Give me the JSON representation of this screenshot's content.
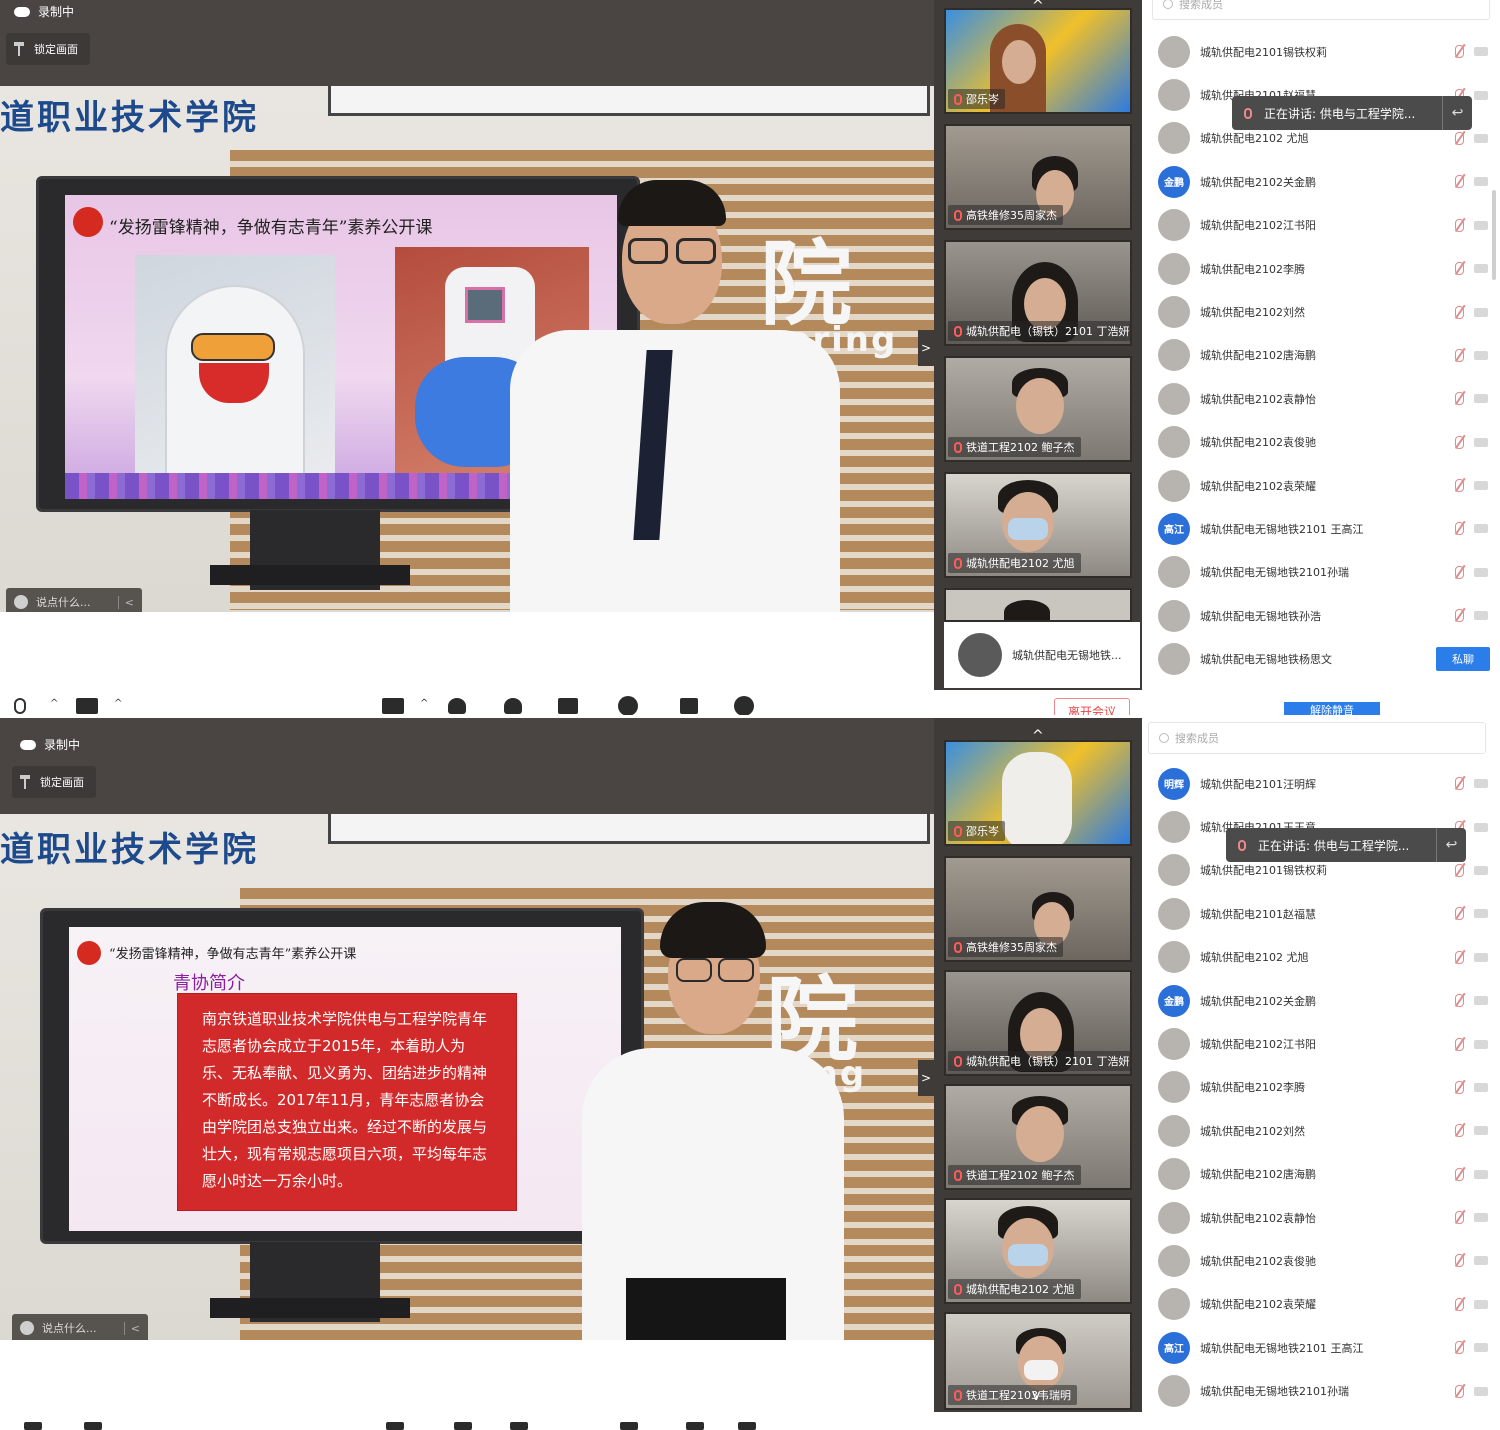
{
  "recording_label": "录制中",
  "lock_screen_label": "锁定画面",
  "say_placeholder": "说点什么...",
  "say_collapse": "<",
  "search_placeholder": "搜索成员",
  "speaking_toast": "正在讲话: 供电与工程学院...",
  "dm_label": "私聊",
  "unmute_label": "解除静音",
  "leave_label": "离开会议",
  "expand_arrow": ">",
  "up_arrow": "^",
  "down_arrow": "v",
  "toolbar_caret": "^",
  "back_glyph": "↩",
  "school_banner": "道职业技术学院",
  "school_banner_bottom": "道职业技术学院",
  "wall_char": "院",
  "wall_word_top": "neering",
  "wall_word_bottom": "ing",
  "slide_title": "“发扬雷锋精神，争做有志青年”素养公开课",
  "slide_subtitle": "青协简介",
  "slide_body": "南京铁道职业技术学院供电与工程学院青年志愿者协会成立于2015年，本着助人为乐、无私奉献、见义勇为、团结进步的精神不断成长。2017年11月，青年志愿者协会由学院团总支独立出来。经过不断的发展与壮大，现有常规志愿项目六项，平均每年志愿小时达一万余小时。",
  "top": {
    "thumbnails": [
      "邵乐岑",
      "高铁维修35周家杰",
      "城轨供配电（锡铁）2101 丁浩妍",
      "铁道工程2102 鲍子杰",
      "城轨供配电2102 尤旭"
    ],
    "speaking_card_name": "城轨供配电无锡地铁...",
    "members": [
      {
        "name": "城轨供配电2101锡铁权莉",
        "avatar": ""
      },
      {
        "name": "城轨供配电2101赵福慧",
        "avatar": ""
      },
      {
        "name": "城轨供配电2102 尤旭",
        "avatar": ""
      },
      {
        "name": "城轨供配电2102关金鹏",
        "avatar": "金鹏"
      },
      {
        "name": "城轨供配电2102江书阳",
        "avatar": ""
      },
      {
        "name": "城轨供配电2102李腾",
        "avatar": ""
      },
      {
        "name": "城轨供配电2102刘然",
        "avatar": ""
      },
      {
        "name": "城轨供配电2102唐海鹏",
        "avatar": ""
      },
      {
        "name": "城轨供配电2102袁静怡",
        "avatar": ""
      },
      {
        "name": "城轨供配电2102袁俊驰",
        "avatar": ""
      },
      {
        "name": "城轨供配电2102袁荣耀",
        "avatar": ""
      },
      {
        "name": "城轨供配电无锡地铁2101 王高江",
        "avatar": "高江"
      },
      {
        "name": "城轨供配电无锡地铁2101孙瑞",
        "avatar": ""
      },
      {
        "name": "城轨供配电无锡地铁孙浩",
        "avatar": ""
      },
      {
        "name": "城轨供配电无锡地铁杨思文",
        "avatar": ""
      }
    ]
  },
  "bottom": {
    "thumbnails": [
      "邵乐岑",
      "高铁维修35周家杰",
      "城轨供配电（锡铁）2101 丁浩妍",
      "铁道工程2102 鲍子杰",
      "城轨供配电2102 尤旭",
      "铁道工程2103韦瑞明"
    ],
    "members": [
      {
        "name": "城轨供配电2101汪明辉",
        "avatar": "明辉"
      },
      {
        "name": "城轨供配电2101王玉意",
        "avatar": ""
      },
      {
        "name": "城轨供配电2101锡铁权莉",
        "avatar": ""
      },
      {
        "name": "城轨供配电2101赵福慧",
        "avatar": ""
      },
      {
        "name": "城轨供配电2102 尤旭",
        "avatar": ""
      },
      {
        "name": "城轨供配电2102关金鹏",
        "avatar": "金鹏"
      },
      {
        "name": "城轨供配电2102江书阳",
        "avatar": ""
      },
      {
        "name": "城轨供配电2102李腾",
        "avatar": ""
      },
      {
        "name": "城轨供配电2102刘然",
        "avatar": ""
      },
      {
        "name": "城轨供配电2102唐海鹏",
        "avatar": ""
      },
      {
        "name": "城轨供配电2102袁静怡",
        "avatar": ""
      },
      {
        "name": "城轨供配电2102袁俊驰",
        "avatar": ""
      },
      {
        "name": "城轨供配电2102袁荣耀",
        "avatar": ""
      },
      {
        "name": "城轨供配电无锡地铁2101 王高江",
        "avatar": "高江"
      },
      {
        "name": "城轨供配电无锡地铁2101孙瑞",
        "avatar": ""
      }
    ]
  },
  "colors": {
    "accent": "#2b7de9",
    "mic_muted": "#e08a8a",
    "leave": "#e44444"
  }
}
